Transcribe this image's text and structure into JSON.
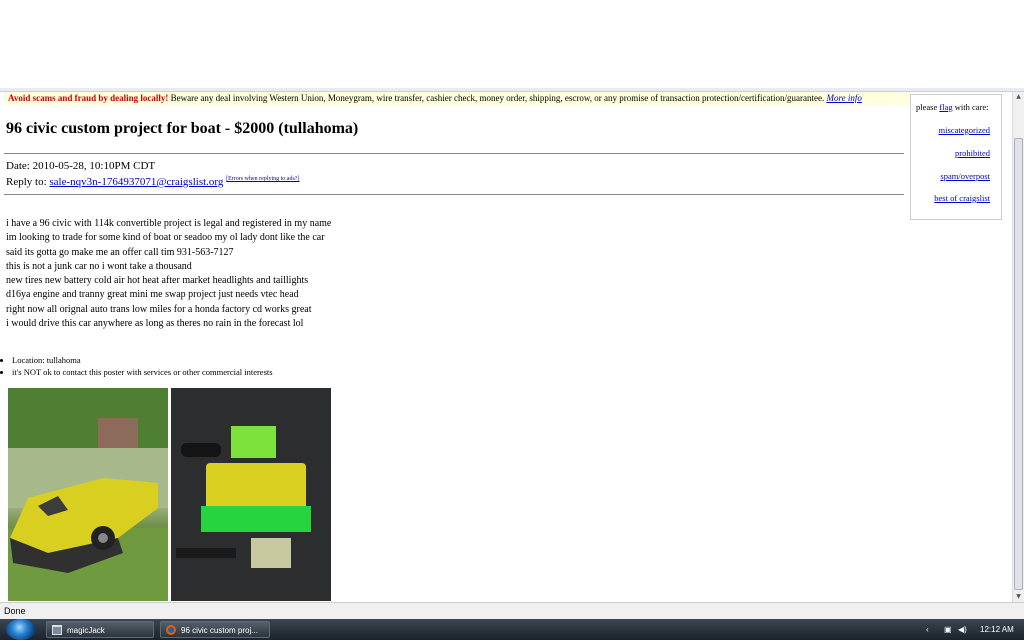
{
  "scam_bar": {
    "strong": "Avoid scams and fraud by dealing locally!",
    "text": " Beware any deal involving Western Union, Moneygram, wire transfer, cashier check, money order, shipping, escrow, or any promise of transaction protection/certification/guarantee. ",
    "link": "More info"
  },
  "posting": {
    "title": "96 civic custom project for boat - $2000 (tullahoma)",
    "date_label": "Date: ",
    "date": "2010-05-28, 10:10PM CDT",
    "reply_label": "Reply to: ",
    "reply_email": "sale-nqv3n-1764937071@craigslist.org",
    "reply_help": "[Errors when replying to ads?]",
    "body": "i have a 96 civic with 114k convertible project is legal and registered in my name\nim looking to trade for some kind of boat or seadoo my ol lady dont like the car\nsaid its gotta go make me an offer call tim 931-563-7127\nthis is not a junk car no i wont take a thousand\nnew tires new battery cold air hot heat after market headlights and taillights\nd16ya engine and tranny great mini me swap project just needs vtec head\nright now all orignal auto trans low miles for a honda factory cd works great\ni would drive this car anywhere as long as theres no rain in the forecast lol",
    "bullets": [
      "Location: tullahoma",
      "it's NOT ok to contact this poster with services or other commercial interests"
    ]
  },
  "flag_box": {
    "prefix": "please ",
    "flag": "flag",
    "suffix": " with care:",
    "links": [
      "miscategorized",
      "prohibited",
      "spam/overpost",
      "best of craigslist"
    ]
  },
  "status_bar": {
    "text": "Done"
  },
  "taskbar": {
    "buttons": [
      "magicJack",
      "96 civic custom proj..."
    ],
    "clock": "12:12 AM"
  },
  "colors": {
    "link": "#0000cc",
    "scam_highlight": "#cc0000",
    "scam_background": "#ffffe0"
  }
}
